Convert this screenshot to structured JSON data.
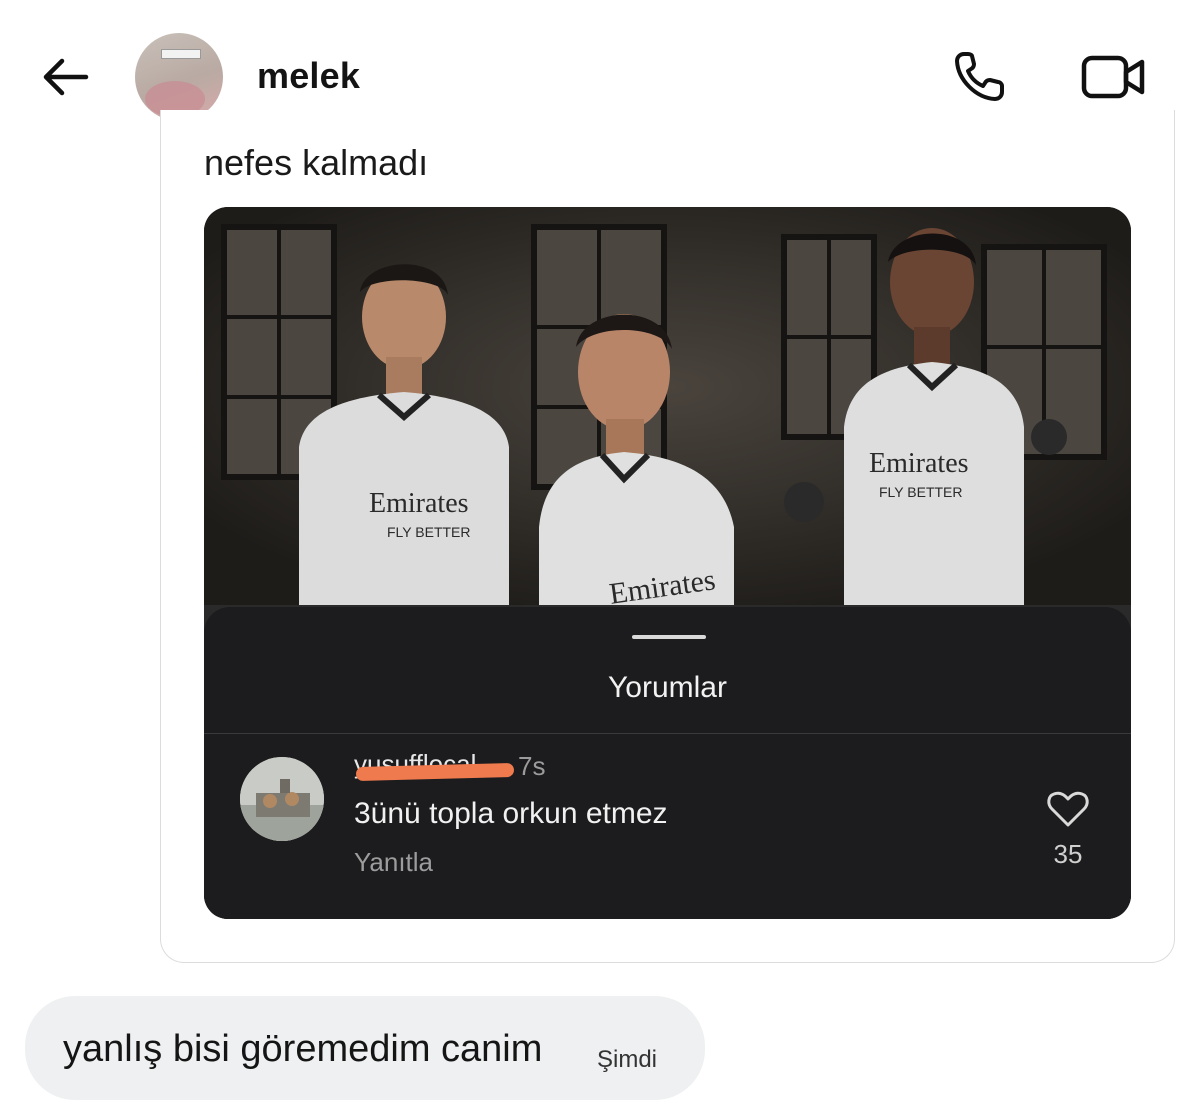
{
  "header": {
    "back_icon": "arrow-left-icon",
    "contact_name": "melek",
    "call_icon": "phone-icon",
    "video_icon": "video-camera-icon"
  },
  "shared_post": {
    "caption": "nefes kalmadı",
    "photo_icon": "photo-three-football-players",
    "comments": {
      "title": "Yorumlar",
      "items": [
        {
          "username": "yusufflocal",
          "time": "7s",
          "text": "3ünü topla orkun etmez",
          "reply_label": "Yanıtla",
          "like_icon": "heart-icon",
          "likes": "35"
        }
      ]
    }
  },
  "message": {
    "text": "yanlış bisi göremedim canim",
    "time": "Şimdi"
  },
  "colors": {
    "bubble_bg": "#eef0f1",
    "sheet_bg": "#1c1c1e",
    "redaction": "#ef7a4d"
  }
}
